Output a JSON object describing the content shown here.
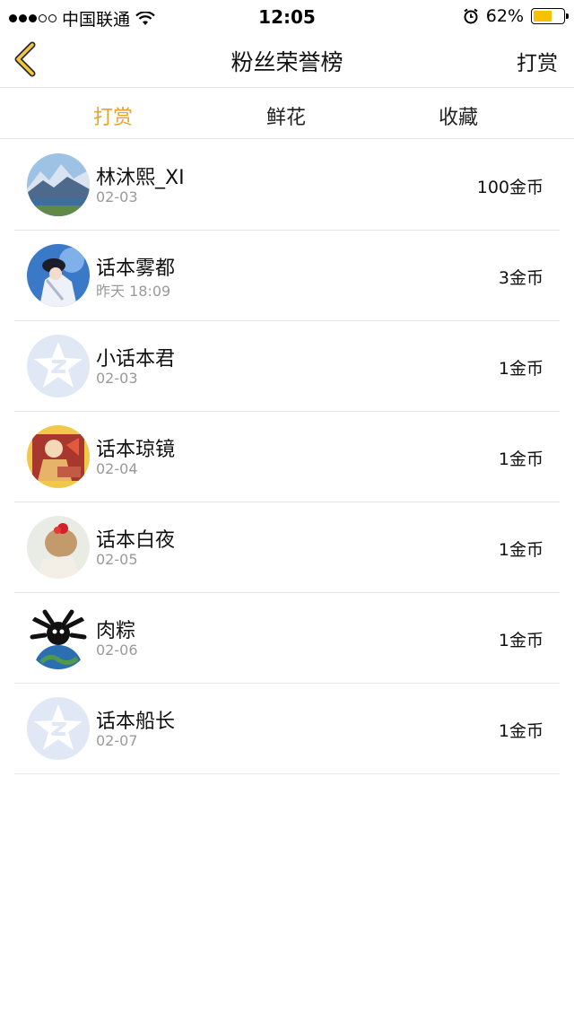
{
  "status": {
    "carrier": "中国联通",
    "time": "12:05",
    "battery": "62%",
    "battery_level": 0.62,
    "signal_dots": [
      true,
      true,
      true,
      false,
      false
    ]
  },
  "nav": {
    "title": "粉丝荣誉榜",
    "right_action": "打赏",
    "back_icon": "chevron-left-icon",
    "accent_color": "#e5a52a"
  },
  "tabs": [
    {
      "label": "打赏",
      "active": true
    },
    {
      "label": "鲜花",
      "active": false
    },
    {
      "label": "收藏",
      "active": false
    }
  ],
  "rows": [
    {
      "name": "林沐熙_XI",
      "date": "02-03",
      "amount": "100金币",
      "avatar": "mountain-lake-avatar"
    },
    {
      "name": "话本雾都",
      "date": "昨天 18:09",
      "amount": "3金币",
      "avatar": "anime-character-avatar"
    },
    {
      "name": "小话本君",
      "date": "02-03",
      "amount": "1金币",
      "avatar": "default-qq-avatar"
    },
    {
      "name": "话本琼镜",
      "date": "02-04",
      "amount": "1金币",
      "avatar": "illustration-avatar"
    },
    {
      "name": "话本白夜",
      "date": "02-05",
      "amount": "1金币",
      "avatar": "girl-hair-flower-avatar"
    },
    {
      "name": "肉粽",
      "date": "02-06",
      "amount": "1金币",
      "avatar": "cartoon-earth-avatar"
    },
    {
      "name": "话本船长",
      "date": "02-07",
      "amount": "1金币",
      "avatar": "default-qq-avatar"
    }
  ]
}
